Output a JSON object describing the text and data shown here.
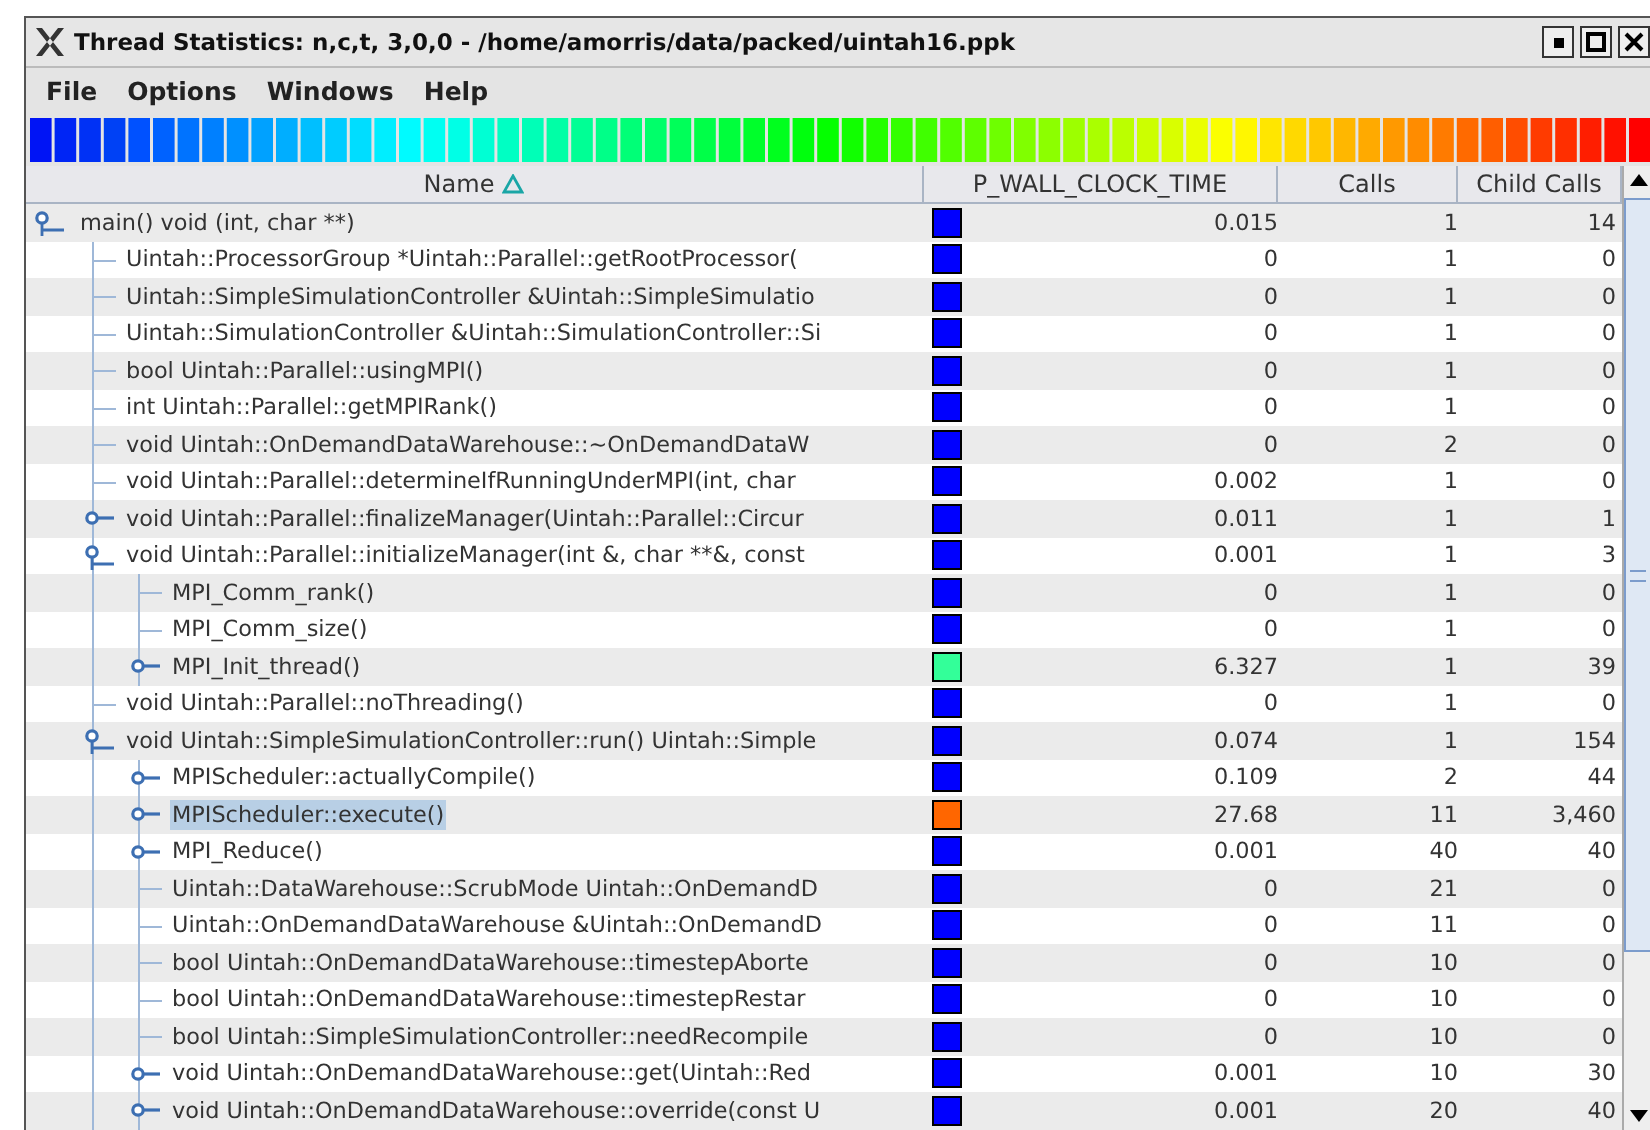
{
  "window": {
    "title": "Thread Statistics: n,c,t, 3,0,0 - /home/amorris/data/packed/uintah16.ppk"
  },
  "menu": [
    "File",
    "Options",
    "Windows",
    "Help"
  ],
  "table": {
    "columns": [
      {
        "label": "Name",
        "sorted": true
      },
      {
        "label": "P_WALL_CLOCK_TIME",
        "sorted": false
      },
      {
        "label": "Calls",
        "sorted": false
      },
      {
        "label": "Child Calls",
        "sorted": false
      }
    ],
    "rows": [
      {
        "name": "main() void (int, char **)",
        "color": "#0000ff",
        "time": "0.015",
        "calls": "1",
        "child_calls": "14",
        "selected": false,
        "expanded": true,
        "children": [
          {
            "name": "Uintah::ProcessorGroup *Uintah::Parallel::getRootProcessor(",
            "color": "#0000ff",
            "time": "0",
            "calls": "1",
            "child_calls": "0",
            "selected": false
          },
          {
            "name": "Uintah::SimpleSimulationController &Uintah::SimpleSimulatio",
            "color": "#0000ff",
            "time": "0",
            "calls": "1",
            "child_calls": "0",
            "selected": false
          },
          {
            "name": "Uintah::SimulationController &Uintah::SimulationController::Si",
            "color": "#0000ff",
            "time": "0",
            "calls": "1",
            "child_calls": "0",
            "selected": false
          },
          {
            "name": "bool Uintah::Parallel::usingMPI()",
            "color": "#0000ff",
            "time": "0",
            "calls": "1",
            "child_calls": "0",
            "selected": false
          },
          {
            "name": "int Uintah::Parallel::getMPIRank()",
            "color": "#0000ff",
            "time": "0",
            "calls": "1",
            "child_calls": "0",
            "selected": false
          },
          {
            "name": "void Uintah::OnDemandDataWarehouse::~OnDemandDataW",
            "color": "#0000ff",
            "time": "0",
            "calls": "2",
            "child_calls": "0",
            "selected": false
          },
          {
            "name": "void Uintah::Parallel::determineIfRunningUnderMPI(int, char",
            "color": "#0000ff",
            "time": "0.002",
            "calls": "1",
            "child_calls": "0",
            "selected": false
          },
          {
            "name": "void Uintah::Parallel::finalizeManager(Uintah::Parallel::Circur",
            "color": "#0000ff",
            "time": "0.011",
            "calls": "1",
            "child_calls": "1",
            "selected": false,
            "expanded": false
          },
          {
            "name": "void Uintah::Parallel::initializeManager(int &, char **&, const",
            "color": "#0000ff",
            "time": "0.001",
            "calls": "1",
            "child_calls": "3",
            "selected": false,
            "expanded": true,
            "children": [
              {
                "name": "MPI_Comm_rank()",
                "color": "#0000ff",
                "time": "0",
                "calls": "1",
                "child_calls": "0",
                "selected": false
              },
              {
                "name": "MPI_Comm_size()",
                "color": "#0000ff",
                "time": "0",
                "calls": "1",
                "child_calls": "0",
                "selected": false
              },
              {
                "name": "MPI_Init_thread()",
                "color": "#33ff99",
                "time": "6.327",
                "calls": "1",
                "child_calls": "39",
                "selected": false,
                "expanded": false
              }
            ]
          },
          {
            "name": "void Uintah::Parallel::noThreading()",
            "color": "#0000ff",
            "time": "0",
            "calls": "1",
            "child_calls": "0",
            "selected": false
          },
          {
            "name": "void Uintah::SimpleSimulationController::run() Uintah::Simple",
            "color": "#0000ff",
            "time": "0.074",
            "calls": "1",
            "child_calls": "154",
            "selected": false,
            "expanded": true,
            "children": [
              {
                "name": "MPIScheduler::actuallyCompile()",
                "color": "#0000ff",
                "time": "0.109",
                "calls": "2",
                "child_calls": "44",
                "selected": false,
                "expanded": false
              },
              {
                "name": "MPIScheduler::execute()",
                "color": "#ff6600",
                "time": "27.68",
                "calls": "11",
                "child_calls": "3,460",
                "selected": true,
                "expanded": false
              },
              {
                "name": "MPI_Reduce()",
                "color": "#0000ff",
                "time": "0.001",
                "calls": "40",
                "child_calls": "40",
                "selected": false,
                "expanded": false
              },
              {
                "name": "Uintah::DataWarehouse::ScrubMode Uintah::OnDemandD",
                "color": "#0000ff",
                "time": "0",
                "calls": "21",
                "child_calls": "0",
                "selected": false
              },
              {
                "name": "Uintah::OnDemandDataWarehouse &Uintah::OnDemandD",
                "color": "#0000ff",
                "time": "0",
                "calls": "11",
                "child_calls": "0",
                "selected": false
              },
              {
                "name": "bool Uintah::OnDemandDataWarehouse::timestepAborte",
                "color": "#0000ff",
                "time": "0",
                "calls": "10",
                "child_calls": "0",
                "selected": false
              },
              {
                "name": "bool Uintah::OnDemandDataWarehouse::timestepRestar",
                "color": "#0000ff",
                "time": "0",
                "calls": "10",
                "child_calls": "0",
                "selected": false
              },
              {
                "name": "bool Uintah::SimpleSimulationController::needRecompile",
                "color": "#0000ff",
                "time": "0",
                "calls": "10",
                "child_calls": "0",
                "selected": false
              },
              {
                "name": "void Uintah::OnDemandDataWarehouse::get(Uintah::Red",
                "color": "#0000ff",
                "time": "0.001",
                "calls": "10",
                "child_calls": "30",
                "selected": false,
                "expanded": false
              },
              {
                "name": "void Uintah::OnDemandDataWarehouse::override(const U",
                "color": "#0000ff",
                "time": "0.001",
                "calls": "20",
                "child_calls": "40",
                "selected": false,
                "expanded": false
              }
            ]
          }
        ]
      }
    ]
  }
}
